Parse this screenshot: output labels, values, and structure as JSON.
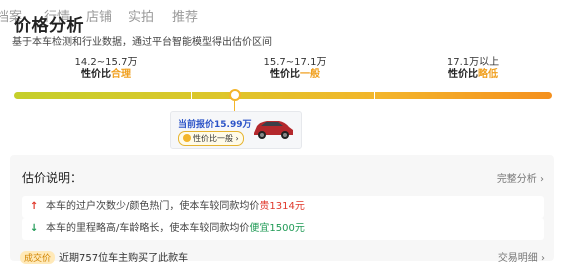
{
  "tabs": [
    "档案",
    "行情",
    "店铺",
    "实拍",
    "推荐"
  ],
  "page_title": "价格分析",
  "subtitle": "基于本车检测和行业数据，通过平台智能模型得出估价区间",
  "ranges": [
    {
      "range": "14.2~15.7万",
      "prefix": "性价比",
      "quality": "合理"
    },
    {
      "range": "15.7~17.1万",
      "prefix": "性价比",
      "quality": "一般"
    },
    {
      "range": "17.1万以上",
      "prefix": "性价比",
      "quality": "略低"
    }
  ],
  "current": {
    "label": "当前报价15.99万",
    "pill": "性价比一般 ›",
    "position_fraction": 0.42
  },
  "estimate": {
    "title": "估价说明：",
    "link": "完整分析 ›",
    "rows": [
      {
        "icon": "↑",
        "text": "本车的过户次数少/颜色热门，使本车较同款均价",
        "amount_prefix": "贵",
        "amount": "1314元"
      },
      {
        "icon": "↓",
        "text": "本车的里程略高/车龄略长，使本车较同款均价",
        "amount_prefix": "便宜",
        "amount": "1500元"
      }
    ]
  },
  "bottom": {
    "badge": "成交价",
    "text": "近期757位车主购买了此款车",
    "link": "交易明细 ›"
  },
  "colors": {
    "bar_start": "#c5cf2a",
    "bar_end": "#f4901e",
    "quality_highlight": "#f0a020",
    "price_up": "#e0382b",
    "price_down": "#1f9a55"
  }
}
